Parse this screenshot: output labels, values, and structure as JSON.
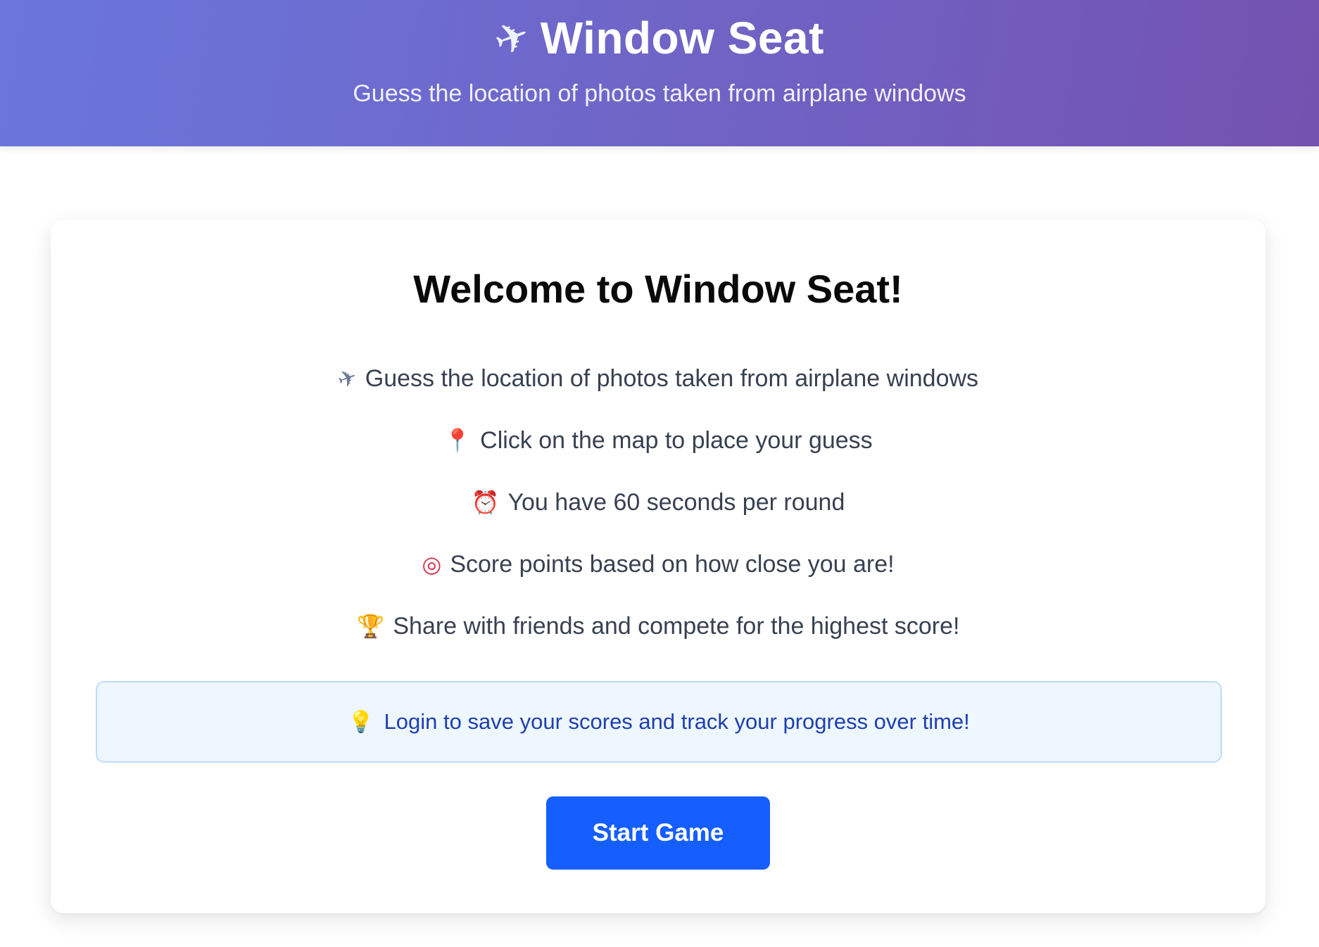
{
  "header": {
    "icon": "airplane-icon",
    "title": "Window Seat",
    "subtitle": "Guess the location of photos taken from airplane windows"
  },
  "welcome": {
    "title": "Welcome to Window Seat!",
    "rules": [
      {
        "icon": "airplane-icon",
        "text": "Guess the location of photos taken from airplane windows"
      },
      {
        "icon": "pushpin-icon",
        "text": "Click on the map to place your guess"
      },
      {
        "icon": "alarm-clock-icon",
        "text": "You have 60 seconds per round"
      },
      {
        "icon": "target-icon",
        "text": "Score points based on how close you are!"
      },
      {
        "icon": "trophy-icon",
        "text": "Share with friends and compete for the highest score!"
      }
    ],
    "login_notice": {
      "icon": "lightbulb-icon",
      "text": "Login to save your scores and track your progress over time!"
    },
    "start_button": "Start Game"
  },
  "colors": {
    "header_gradient_start": "#6a76dc",
    "header_gradient_end": "#7452b0",
    "primary_button": "#155eff",
    "notice_background": "#eef6ff",
    "notice_text": "#1e40af"
  }
}
